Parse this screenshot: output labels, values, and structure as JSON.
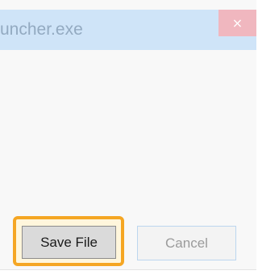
{
  "window": {
    "title": "uncher.exe",
    "close_glyph": "×"
  },
  "buttons": {
    "save_label": "Save File",
    "cancel_label": "Cancel"
  },
  "colors": {
    "titlebar": "#cfe4f8",
    "close_button": "#f0b7bf",
    "highlight": "#f5a623"
  }
}
